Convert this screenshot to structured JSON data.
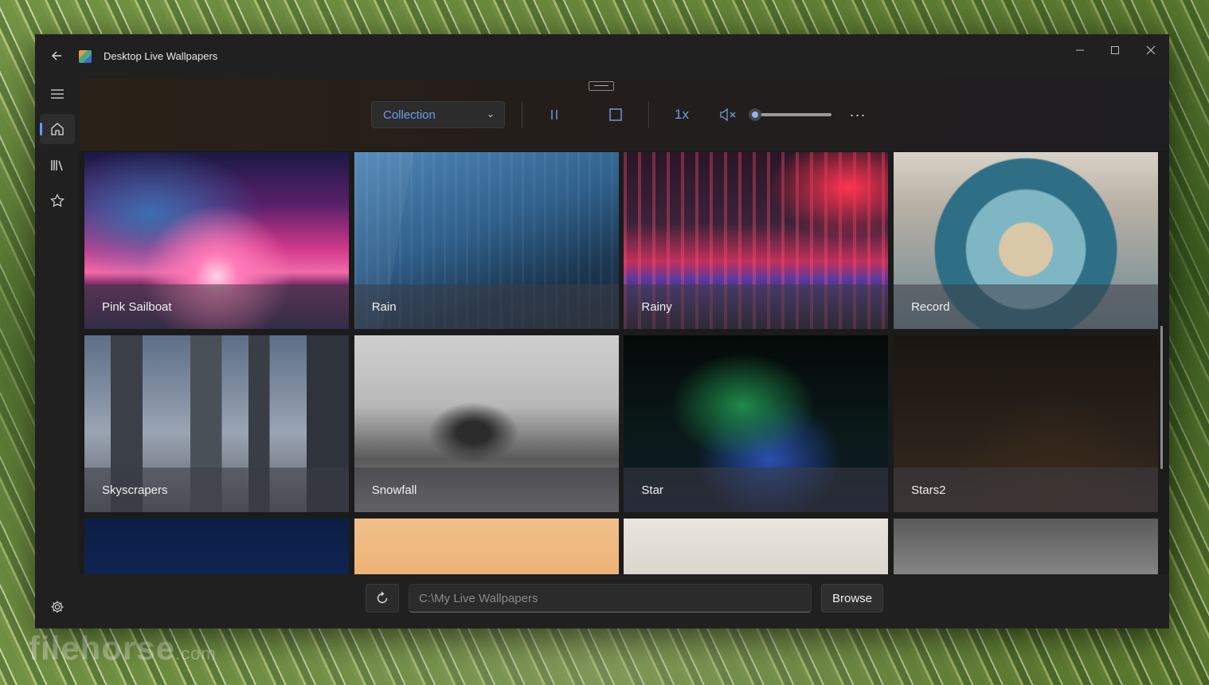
{
  "window": {
    "title": "Desktop Live Wallpapers",
    "controls": [
      "minimize-icon",
      "maximize-icon",
      "close-icon"
    ]
  },
  "sidebar": {
    "items": [
      {
        "icon": "hamburger-menu-icon"
      },
      {
        "icon": "home-icon",
        "active": true
      },
      {
        "icon": "library-icon"
      },
      {
        "icon": "star-icon"
      }
    ],
    "settings_icon": "gear-icon"
  },
  "toolbar": {
    "collection_label": "Collection",
    "speed_label": "1x",
    "volume_muted": true,
    "volume_level": 0,
    "accent_color": "#6f9ee8",
    "more_label": "···"
  },
  "wallpapers": [
    {
      "label": "Pink Sailboat"
    },
    {
      "label": "Rain"
    },
    {
      "label": "Rainy"
    },
    {
      "label": "Record"
    },
    {
      "label": "Skyscrapers"
    },
    {
      "label": "Snowfall"
    },
    {
      "label": "Star"
    },
    {
      "label": "Stars2"
    },
    {
      "label": ""
    },
    {
      "label": ""
    },
    {
      "label": ""
    },
    {
      "label": ""
    }
  ],
  "footer": {
    "path_placeholder": "C:\\My Live Wallpapers",
    "browse_label": "Browse"
  },
  "watermark": {
    "text": "filehorse",
    "suffix": ".com"
  }
}
